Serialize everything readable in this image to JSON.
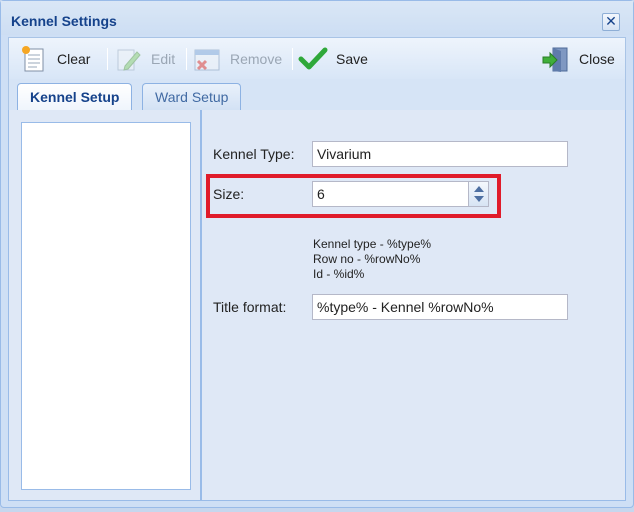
{
  "window": {
    "title": "Kennel Settings"
  },
  "toolbar": {
    "clear": {
      "label": "Clear",
      "icon": "clear-icon"
    },
    "edit": {
      "label": "Edit",
      "icon": "pencil-icon"
    },
    "remove": {
      "label": "Remove",
      "icon": "remove-icon"
    },
    "save": {
      "label": "Save",
      "icon": "checkmark-icon"
    },
    "close": {
      "label": "Close",
      "icon": "exit-door-icon"
    }
  },
  "tabs": [
    {
      "label": "Kennel Setup",
      "active": true
    },
    {
      "label": "Ward Setup",
      "active": false
    }
  ],
  "form": {
    "kennel_type": {
      "label": "Kennel Type:",
      "value": "Vivarium"
    },
    "size": {
      "label": "Size:",
      "value": "6"
    },
    "help_lines": [
      "Kennel type - %type%",
      "Row no - %rowNo%",
      "Id - %id%"
    ],
    "title_format": {
      "label": "Title format:",
      "value": "%type% - Kennel %rowNo%"
    }
  },
  "colors": {
    "title": "#15428b",
    "highlight": "#e01b2a",
    "save_check": "#2fa83a"
  }
}
